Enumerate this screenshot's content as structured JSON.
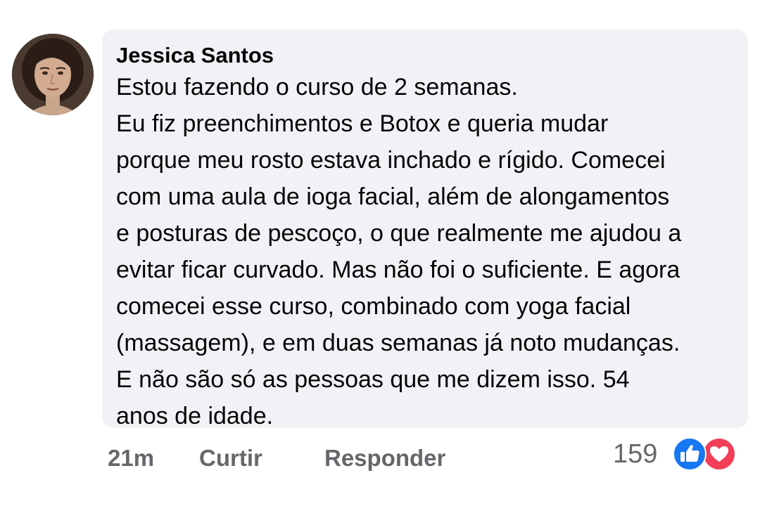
{
  "comment": {
    "author": "Jessica Santos",
    "lines": [
      "Estou fazendo o curso de 2 semanas.",
      "Eu fiz preenchimentos e Botox e queria mudar",
      "porque meu rosto estava inchado e rígido. Comecei",
      "com uma aula de ioga facial, além de alongamentos",
      "e posturas de pescoço, o que realmente me ajudou a",
      "evitar ficar curvado. Mas não foi o suficiente. E agora",
      "comecei esse curso, combinado com yoga facial",
      "(massagem), e em duas semanas já noto mudanças.",
      "E não são só as pessoas que me dizem isso. 54",
      "anos de idade."
    ]
  },
  "actions": {
    "time": "21m",
    "like_label": "Curtir",
    "reply_label": "Responder"
  },
  "reactions": {
    "count": "159",
    "icons": [
      "like-icon",
      "love-icon"
    ],
    "colors": {
      "like": "#1877f2",
      "love": "#f33e58"
    }
  }
}
